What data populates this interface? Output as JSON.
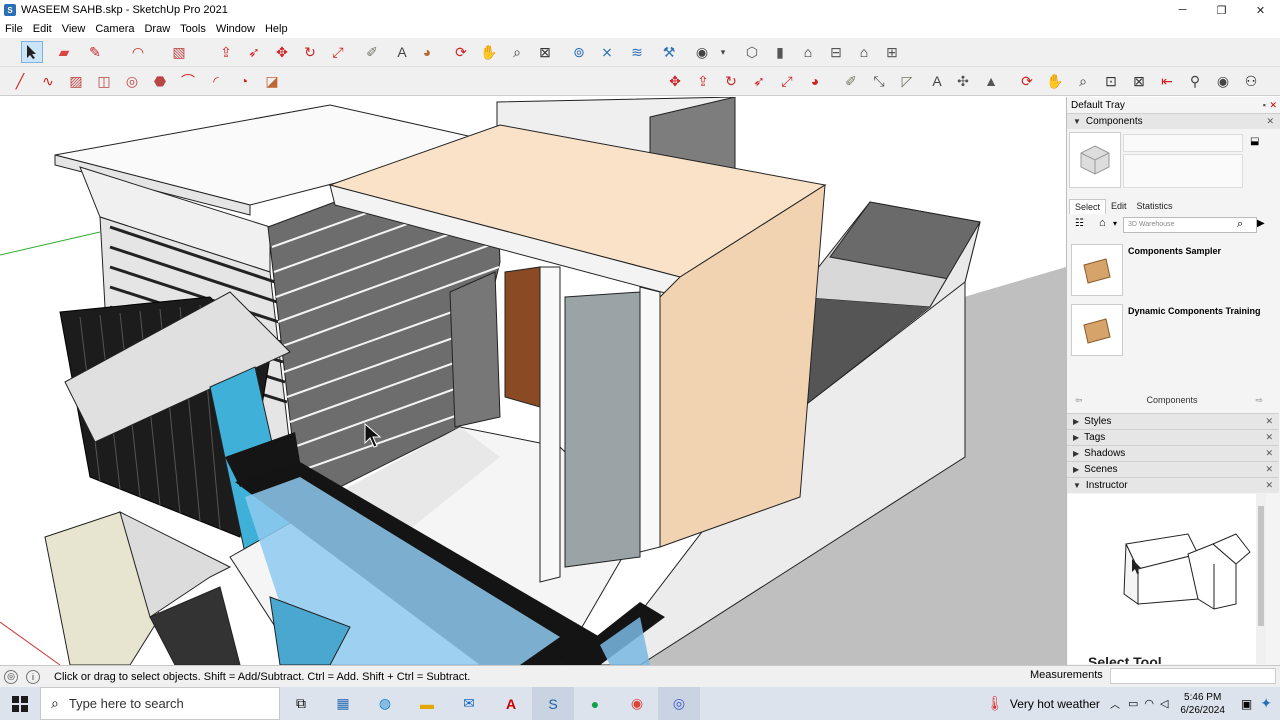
{
  "window": {
    "title": "WASEEM SAHB.skp - SketchUp Pro 2021",
    "minimize": "─",
    "maximize": "❐",
    "close": "✕"
  },
  "menu": [
    "File",
    "Edit",
    "View",
    "Camera",
    "Draw",
    "Tools",
    "Window",
    "Help"
  ],
  "tray": {
    "title": "Default Tray",
    "components_header": "Components",
    "tabs": [
      "Select",
      "Edit",
      "Statistics"
    ],
    "search_placeholder": "3D Warehouse",
    "items": [
      {
        "name": "Components Sampler"
      },
      {
        "name": "Dynamic Components Training"
      }
    ],
    "components_label": "Components",
    "sections": [
      "Styles",
      "Tags",
      "Shadows",
      "Scenes",
      "Instructor"
    ],
    "instructor_title": "Select Tool"
  },
  "status": {
    "message": "Click or drag to select objects. Shift = Add/Subtract. Ctrl = Add. Shift + Ctrl = Subtract.",
    "measurements_label": "Measurements"
  },
  "taskbar": {
    "search_placeholder": "Type here to search",
    "weather": "Very hot weather",
    "time": "5:46 PM",
    "date": "6/26/2024"
  }
}
